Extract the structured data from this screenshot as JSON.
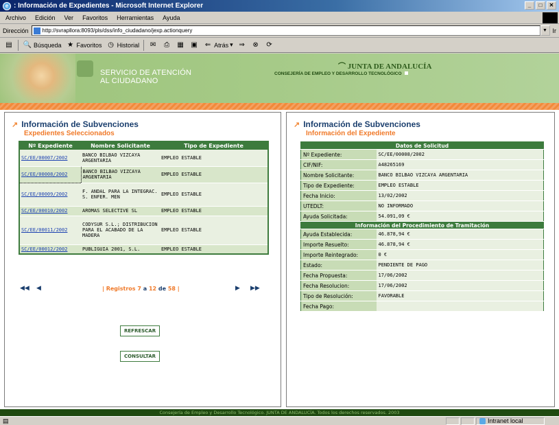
{
  "window": {
    "title": ": Información de Expedientes - Microsoft Internet Explorer",
    "controls": [
      "_",
      "□",
      "✕"
    ]
  },
  "menu": [
    "Archivo",
    "Edición",
    "Ver",
    "Favoritos",
    "Herramientas",
    "Ayuda"
  ],
  "address": {
    "label": "Dirección",
    "url": "http://svrapllora:8093/pls/dss/info_ciudadano/jexp.actionquery",
    "go_label": "Ir"
  },
  "toolbar": {
    "search": "Búsqueda",
    "favorites": "Favoritos",
    "history": "Historial",
    "back": "Atrás"
  },
  "banner": {
    "service_line1": "Servicio de Atención",
    "service_line2": "al Ciudadano",
    "junta": "Junta de Andalucía",
    "consejeria": "Consejería de Empleo y Desarrollo Tecnológico"
  },
  "left": {
    "title": "Información de Subvenciones",
    "subtitle": "Expedientes Seleccionados",
    "columns": [
      "Nº Expediente",
      "Nombre Solicitante",
      "Tipo de Expediente"
    ],
    "rows": [
      {
        "exp": "SC/EE/00007/2002",
        "name": "BANCO BILBAO VIZCAYA ARGENTARIA",
        "type": "EMPLEO ESTABLE"
      },
      {
        "exp": "SC/EE/00008/2002",
        "name": "BANCO BILBAO VIZCAYA ARGENTARIA",
        "type": "EMPLEO ESTABLE"
      },
      {
        "exp": "SC/EE/00009/2002",
        "name": "F. ANDAL PARA LA INTEGRAC. S. ENFER. MEN",
        "type": "EMPLEO ESTABLE"
      },
      {
        "exp": "SC/EE/00010/2002",
        "name": "AROMAS SELECTIVE SL",
        "type": "EMPLEO ESTABLE"
      },
      {
        "exp": "SC/EE/00011/2002",
        "name": "CODYSUR S.L.; DISTRIBUCION PARA EL ACABADO DE LA MADERA",
        "type": "EMPLEO ESTABLE"
      },
      {
        "exp": "SC/EE/00012/2002",
        "name": "PUBLIGUIA 2001, S.L.",
        "type": "EMPLEO ESTABLE"
      }
    ],
    "pager": {
      "first": "◀◀",
      "prev": "◀",
      "next": "▶",
      "last": "▶▶",
      "prefix": "| Registros",
      "from": "7",
      "a": "a",
      "to": "12",
      "de": "de",
      "total": "58",
      "suffix": "|"
    },
    "refresh_label": "REFRESCAR",
    "consult_label": "CONSULTAR"
  },
  "right": {
    "title": "Información de Subvenciones",
    "subtitle": "Información del Expediente",
    "section1": "Datos de Solicitud",
    "fields1": [
      {
        "label": "Nº Expediente:",
        "value": "SC/EE/00008/2002"
      },
      {
        "label": "CIF/NIF:",
        "value": "A48265169"
      },
      {
        "label": "Nombre Solicitante:",
        "value": "BANCO BILBAO VIZCAYA ARGENTARIA"
      },
      {
        "label": "Tipo de Expediente:",
        "value": "EMPLEO ESTABLE"
      },
      {
        "label": "Fecha Inicio:",
        "value": "13/02/2002"
      },
      {
        "label": "UTEDLT:",
        "value": "NO INFORMADO"
      },
      {
        "label": "Ayuda Solicitada:",
        "value": "54.091,09 €"
      }
    ],
    "section2": "Información del Procedimiento de Tramitación",
    "fields2": [
      {
        "label": "Ayuda Establecida:",
        "value": "46.878,94 €"
      },
      {
        "label": "Importe Resuelto:",
        "value": "46.878,94 €"
      },
      {
        "label": "Importe Reintegrado:",
        "value": "0 €"
      },
      {
        "label": "Estado:",
        "value": "PENDIENTE DE PAGO"
      },
      {
        "label": "Fecha Propuesta:",
        "value": "17/06/2002"
      },
      {
        "label": "Fecha Resolucion:",
        "value": "17/06/2002"
      },
      {
        "label": "Tipo de Resolución:",
        "value": "FAVORABLE"
      },
      {
        "label": "Fecha Pago:",
        "value": ""
      }
    ]
  },
  "footer": "Consejería de Empleo y Desarrollo Tecnológico. JUNTA DE ANDALUCÍA. Todos los derechos reservados. 2003",
  "status": {
    "left": "",
    "zone": "Intranet local"
  }
}
